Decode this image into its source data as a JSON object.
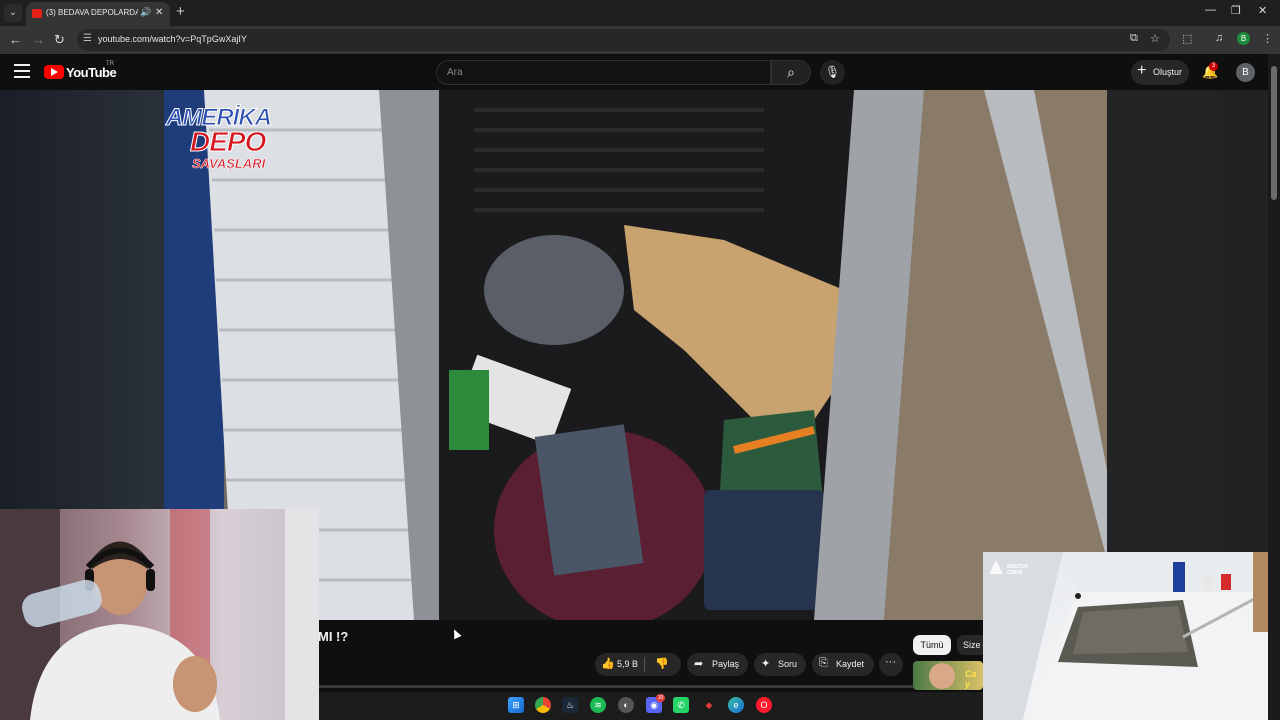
{
  "browser": {
    "tab_title": "(3) BEDAVA DEPOLARDA Y...",
    "url": "youtube.com/watch?v=PqTpGwXajIY",
    "profile_initial": "B"
  },
  "youtube": {
    "logo_word": "YouTube",
    "country_code": "TR",
    "search_placeholder": "Ara",
    "create_label": "Oluştur",
    "notification_count": "3",
    "avatar_initial": "B"
  },
  "video": {
    "overlay_logo": [
      "AMERİKA",
      "DEPO",
      "SAVAŞLARI"
    ],
    "title_fragment": "MI !?",
    "like_count": "5,9 B",
    "share_label": "Paylaş",
    "ask_label": "Soru",
    "save_label": "Kaydet"
  },
  "sidebar_chips": {
    "all": "Tümü",
    "for_you": "Size"
  },
  "recommendation": {
    "thumb_text": "Ca y"
  },
  "pip": {
    "brand_text": "BANTER CREW"
  },
  "taskbar": {
    "apps": [
      "windows-start",
      "chrome",
      "steam",
      "spotify",
      "github-desktop",
      "discord",
      "whatsapp",
      "roblox",
      "edge",
      "opera"
    ],
    "discord_badge": "10"
  },
  "colors": {
    "youtube_red": "#ff0000",
    "background": "#0f0f0f",
    "chip_active": "#f1f1f1"
  }
}
